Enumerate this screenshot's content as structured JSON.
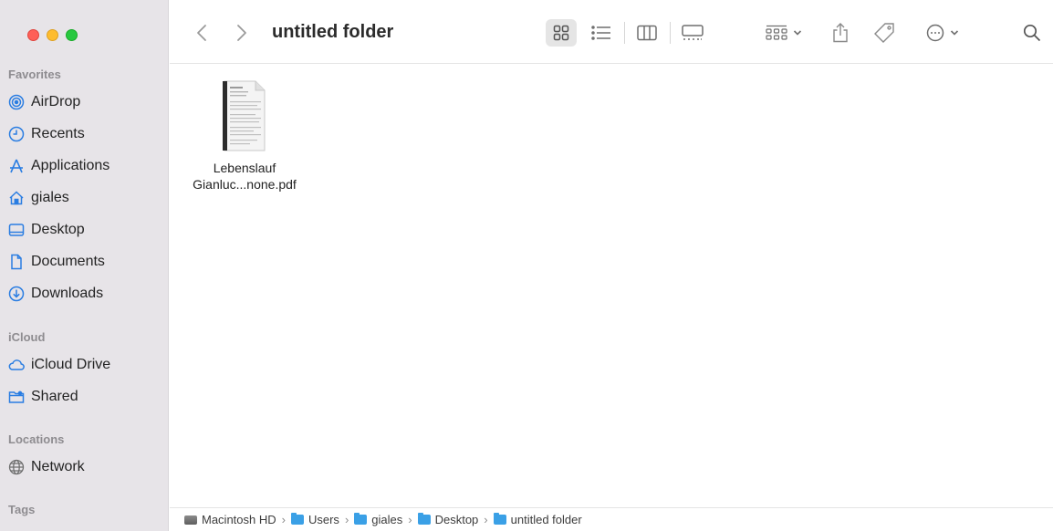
{
  "window": {
    "title": "untitled folder"
  },
  "sidebar": {
    "favorites_title": "Favorites",
    "favorites": [
      {
        "label": "AirDrop",
        "icon": "airdrop-icon"
      },
      {
        "label": "Recents",
        "icon": "clock-icon"
      },
      {
        "label": "Applications",
        "icon": "applications-icon"
      },
      {
        "label": "giales",
        "icon": "home-icon"
      },
      {
        "label": "Desktop",
        "icon": "desktop-icon"
      },
      {
        "label": "Documents",
        "icon": "document-icon"
      },
      {
        "label": "Downloads",
        "icon": "download-icon"
      }
    ],
    "icloud_title": "iCloud",
    "icloud": [
      {
        "label": "iCloud Drive",
        "icon": "cloud-icon"
      },
      {
        "label": "Shared",
        "icon": "shared-folder-icon"
      }
    ],
    "locations_title": "Locations",
    "locations": [
      {
        "label": "Network",
        "icon": "network-icon"
      }
    ],
    "tags_title": "Tags"
  },
  "files": [
    {
      "name_line1": "Lebenslauf",
      "name_line2": "Gianluc...none.pdf",
      "type": "pdf"
    }
  ],
  "pathbar": {
    "items": [
      "Macintosh HD",
      "Users",
      "giales",
      "Desktop",
      "untitled folder"
    ],
    "separator": "›"
  },
  "colors": {
    "sidebar_bg": "#e7e4e8",
    "accent": "#2a7de2",
    "traffic_red": "#fe5f57",
    "traffic_yellow": "#febc2e",
    "traffic_green": "#28c840"
  }
}
